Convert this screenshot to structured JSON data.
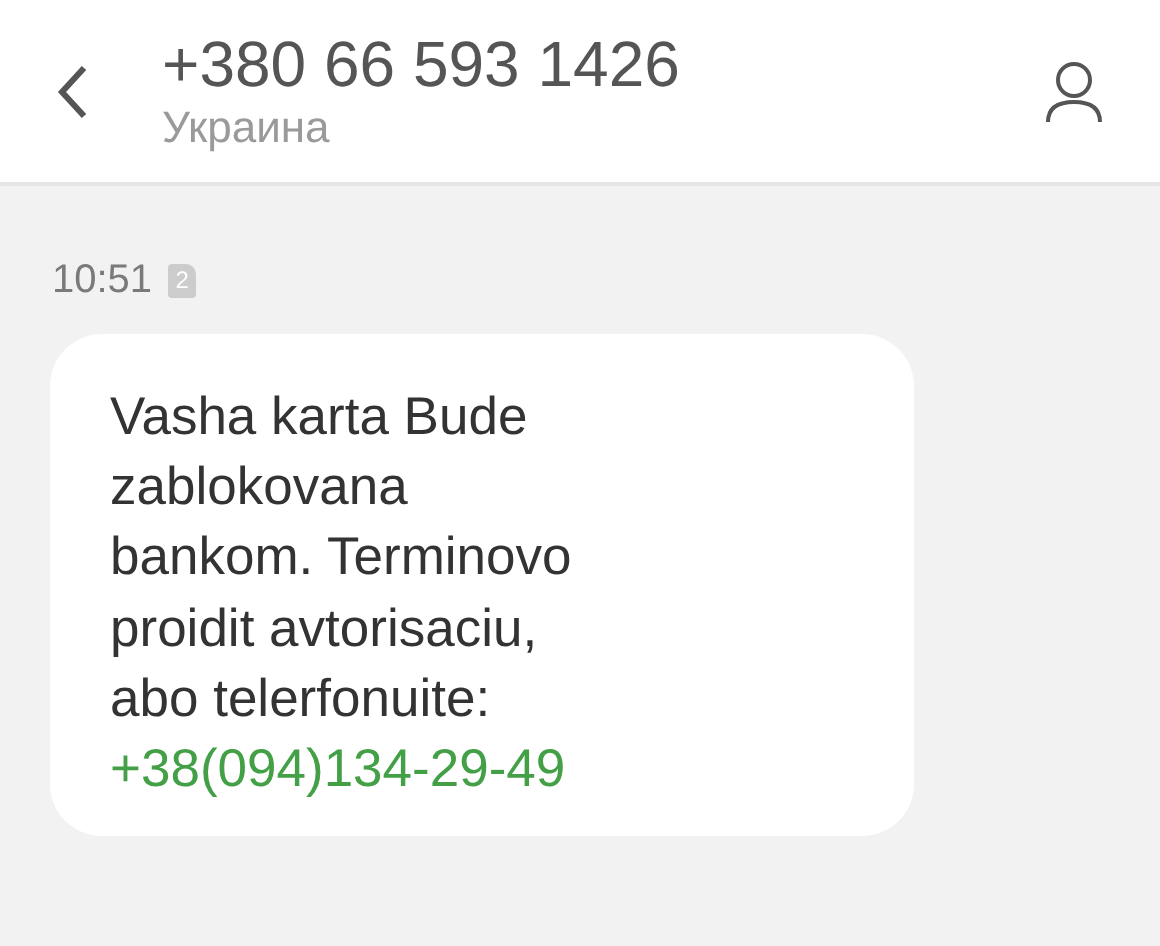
{
  "header": {
    "title": "+380 66 593 1426",
    "subtitle": "Украина"
  },
  "messages": [
    {
      "time": "10:51",
      "sim": "2",
      "lines": [
        "Vasha karta Bude",
        "zablokovana",
        "bankom. Terminovo",
        "proidit avtorisaciu,",
        "abo telerfonuite:"
      ],
      "link": "+38(094)134-29-49"
    }
  ]
}
